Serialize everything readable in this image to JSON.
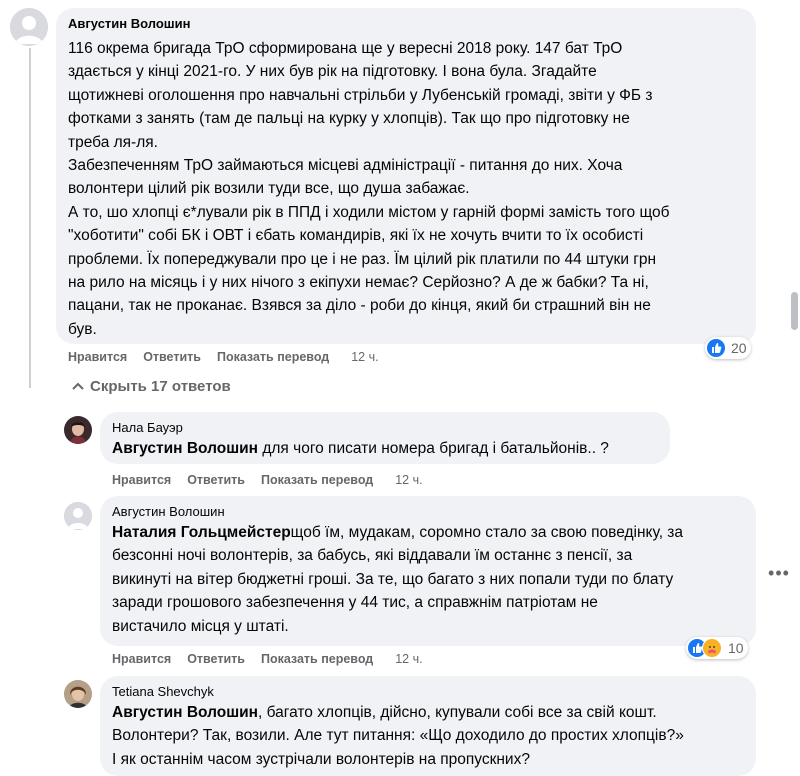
{
  "top_cut_text": "",
  "comments": [
    {
      "author": "Августин Волошин",
      "lines": [
        "116 окрема бригада ТрО сформирована ще у вересні 2018 року. 147 бат ТрО",
        "здається у кінці 2021-го. У них був рік на підготовку. І вона була. Згадайте",
        "щотижневі оголошення про навчальні стрільби у Лубенській громаді, звіти у ФБ з",
        "фотками з занять (там де пальці на курку у хлопців). Так що про підготовку не",
        "треба ля-ля.",
        "Забезпеченням ТрО займаються місцеві адміністрації - питання до них. Хоча",
        "волонтери цілий рік возили туди все, що душа забажає.",
        "А то, шо хлопці є*лували рік в ППД і ходили містом у гарній формі замість того щоб",
        "\"хоботити\" собі БК і ОВТ і єбать командирів, які їх не хочуть вчити то їх особисті",
        "проблеми. Їх попереджували про це і не раз. Їм цілий рік платили по 44 штуки грн",
        "на рило на місяць і у них нічого з екіпухи немає? Серйозно? А де ж бабки? Та ні,",
        "пацани, так не проканає. Взявся за діло - роби до кінця, який би страшний він не",
        "був."
      ],
      "actions": {
        "like": "Нравится",
        "reply": "Ответить",
        "translate": "Показать перевод",
        "time": "12 ч."
      },
      "reactions_count": "20"
    }
  ],
  "hide_replies_label": "Скрыть 17 ответов",
  "replies": [
    {
      "author": "Нала Бауэр",
      "mention": "Августин Волошин",
      "lines_after_mention": [
        " для чого писати номера бригад і батальйонів.. ?"
      ],
      "actions": {
        "like": "Нравится",
        "reply": "Ответить",
        "translate": "Показать перевод",
        "time": "12 ч."
      }
    },
    {
      "author": "Августин Волошин",
      "mention": "Наталия Гольцмейстер",
      "first_line_rest": "щоб їм, мудакам, соромно стало за свою поведінку, за",
      "lines": [
        "безсонні ночі волонтерів, за бабусь, які віддавали їм останнє з пенсії, за",
        "викинуті на вітер бюджетні гроші. За те, що багато з них попали туди по блату",
        "заради грошового забезпечення у 44 тис, а справжнім патріотам не",
        "вистачило місця у штаті."
      ],
      "actions": {
        "like": "Нравится",
        "reply": "Ответить",
        "translate": "Показать перевод",
        "time": "12 ч."
      },
      "reactions_count": "10"
    },
    {
      "author": "Tetiana Shevchyk",
      "mention": "Августин Волошин",
      "first_line_rest": ", багато хлопців, дійсно, купували собі все за свій кошт.",
      "lines": [
        "Волонтери? Так, возили. Але тут питання: «Що доходило до простих хлопців?»",
        "І як останнім часом зустрічали волонтерів на пропускних?"
      ]
    }
  ],
  "more_icon": "more-horizontal-icon",
  "colors": {
    "bubble": "#f0f2f5",
    "secondary_text": "#65676b",
    "like_blue": "#1877f2"
  }
}
